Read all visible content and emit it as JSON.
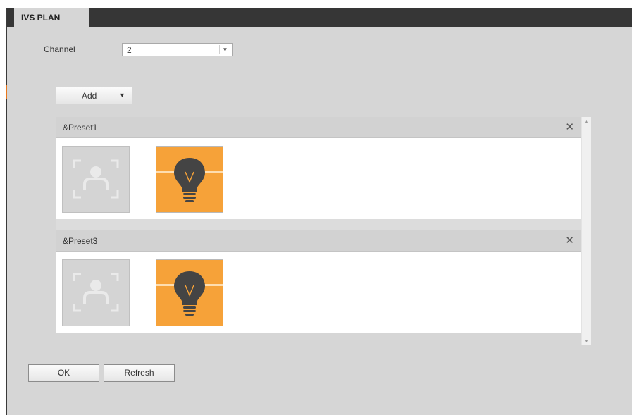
{
  "tab": {
    "title": "IVS PLAN"
  },
  "channel": {
    "label": "Channel",
    "value": "2"
  },
  "add_button": {
    "label": "Add"
  },
  "presets": [
    {
      "name": "&Preset1"
    },
    {
      "name": "&Preset3"
    }
  ],
  "buttons": {
    "ok": "OK",
    "refresh": "Refresh"
  },
  "colors": {
    "tab_bar": "#363636",
    "background": "#d6d6d6",
    "accent": "#e8781e",
    "rule_tile": "#f6a239"
  },
  "icons": {
    "face_detect": "face-detection-icon",
    "lightbulb": "lightbulb-icon",
    "close": "close-icon"
  }
}
